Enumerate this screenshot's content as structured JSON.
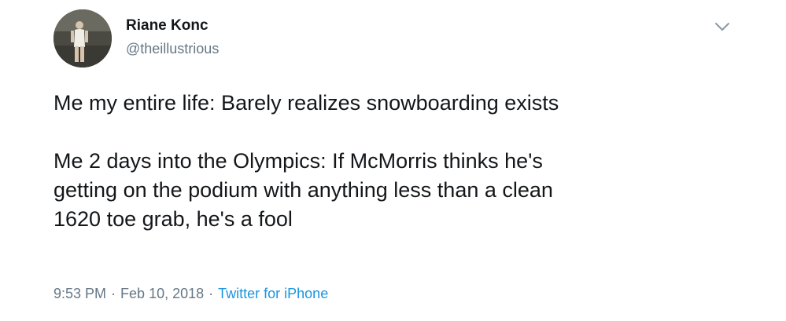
{
  "tweet": {
    "display_name": "Riane Konc",
    "handle": "@theillustrious",
    "paragraphs": [
      "Me my entire life: Barely realizes snowboarding exists",
      "Me 2 days into the Olympics: If McMorris thinks he's\ngetting on the podium with anything less than a clean\n1620 toe grab, he's a fool"
    ],
    "time": "9:53 PM",
    "date": "Feb 10, 2018",
    "separator": "·",
    "source": "Twitter for iPhone"
  },
  "icons": {
    "menu": "chevron-down-icon"
  },
  "colors": {
    "text": "#14171a",
    "secondary": "#657786",
    "link": "#1b95e0",
    "background": "#ffffff"
  }
}
